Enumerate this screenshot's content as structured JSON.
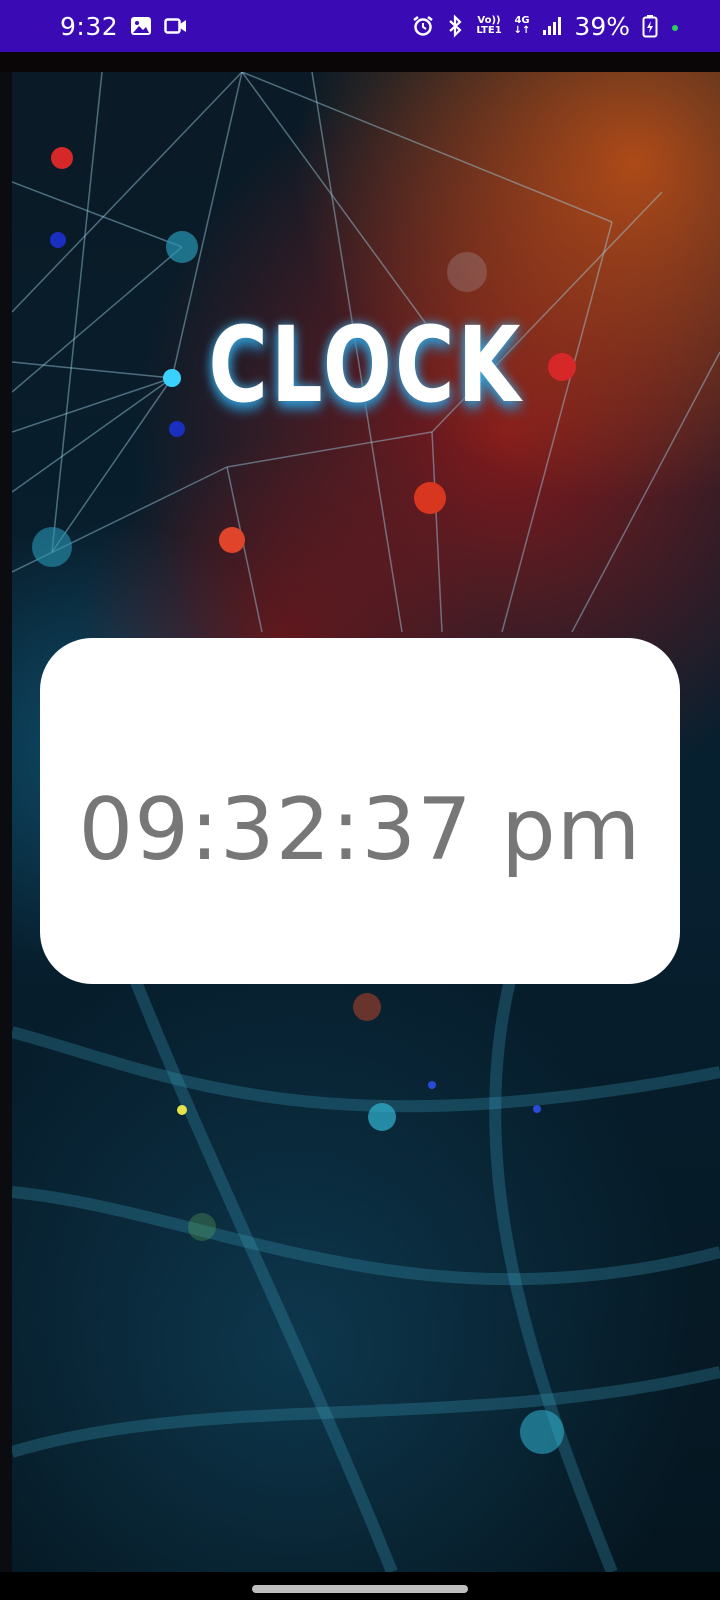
{
  "status_bar": {
    "time": "9:32",
    "network_top": "Vo))",
    "network_bottom": "LTE1",
    "mobile_top": "4G",
    "mobile_bottom": "↓↑",
    "battery": "39%",
    "background_color": "#3a0bb5"
  },
  "app": {
    "title": "CLOCK",
    "time_display": "09:32:37 pm"
  },
  "icons": [
    "image-icon",
    "video-icon",
    "alarm-icon",
    "bluetooth-icon",
    "signal-icon",
    "battery-charging-icon"
  ]
}
